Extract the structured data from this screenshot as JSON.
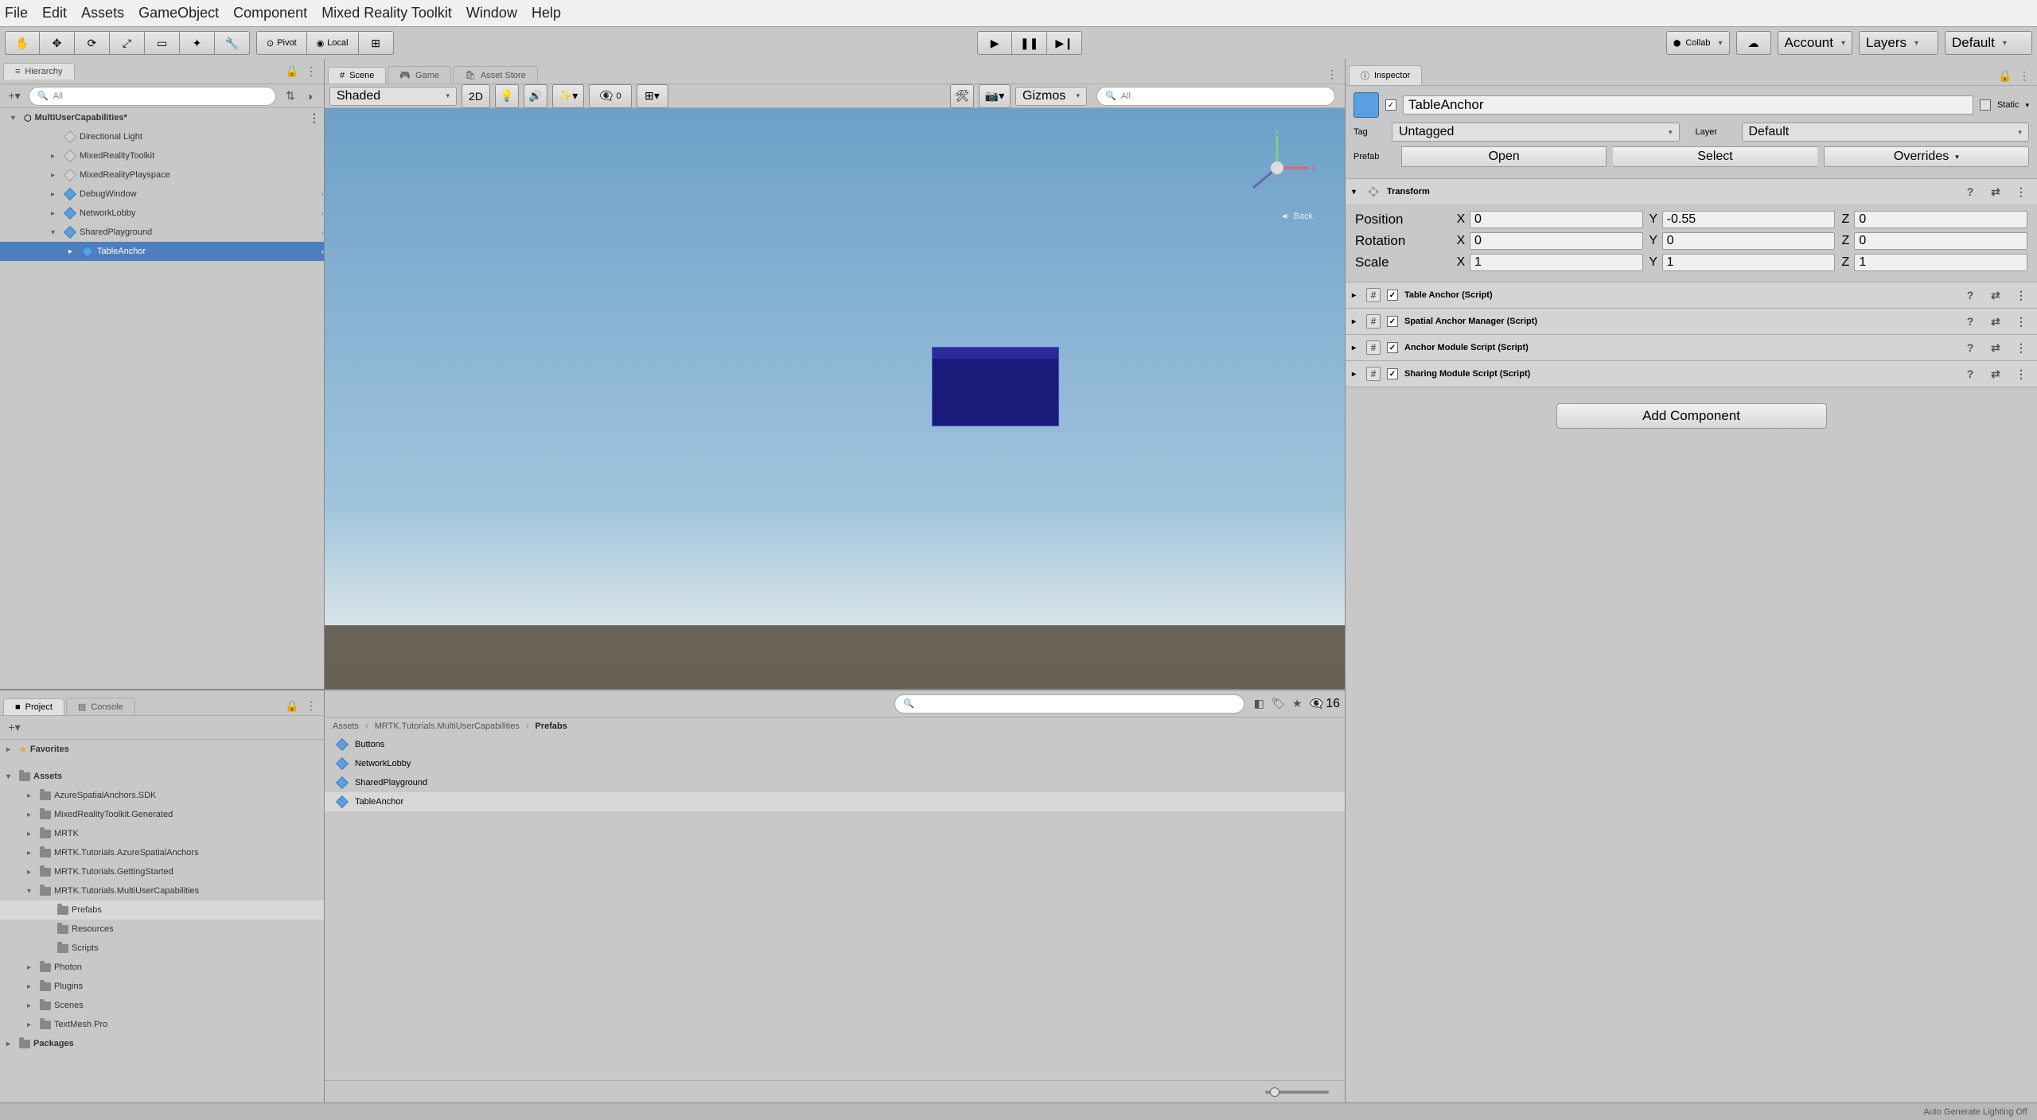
{
  "menubar": [
    "File",
    "Edit",
    "Assets",
    "GameObject",
    "Component",
    "Mixed Reality Toolkit",
    "Window",
    "Help"
  ],
  "toolbar": {
    "pivot": "Pivot",
    "local": "Local",
    "collab": "Collab",
    "account": "Account",
    "layers": "Layers",
    "layout": "Default"
  },
  "hierarchy": {
    "title": "Hierarchy",
    "search_placeholder": "All",
    "scene": "MultiUserCapabilities*",
    "items": [
      {
        "name": "Directional Light",
        "icon": "gray",
        "indent": 2,
        "arrow": ""
      },
      {
        "name": "MixedRealityToolkit",
        "icon": "gray",
        "indent": 2,
        "arrow": "▸"
      },
      {
        "name": "MixedRealityPlayspace",
        "icon": "gray",
        "indent": 2,
        "arrow": "▸"
      },
      {
        "name": "DebugWindow",
        "icon": "blue",
        "indent": 2,
        "arrow": "▸",
        "chev": true
      },
      {
        "name": "NetworkLobby",
        "icon": "blue",
        "indent": 2,
        "arrow": "▸",
        "chev": true
      },
      {
        "name": "SharedPlayground",
        "icon": "blue",
        "indent": 2,
        "arrow": "▾",
        "chev": true
      },
      {
        "name": "TableAnchor",
        "icon": "blue",
        "indent": 3,
        "arrow": "▸",
        "chev": true,
        "selected": true
      }
    ]
  },
  "scene_tabs": {
    "scene": "Scene",
    "game": "Game",
    "store": "Asset Store"
  },
  "scene_toolbar": {
    "shaded": "Shaded",
    "mode2d": "2D",
    "zero": "0",
    "gizmos": "Gizmos",
    "search_placeholder": "All"
  },
  "scene_view": {
    "back": "Back"
  },
  "inspector": {
    "title": "Inspector",
    "name": "TableAnchor",
    "static": "Static",
    "tag_label": "Tag",
    "tag_value": "Untagged",
    "layer_label": "Layer",
    "layer_value": "Default",
    "prefab_label": "Prefab",
    "open": "Open",
    "select": "Select",
    "overrides": "Overrides",
    "transform": {
      "title": "Transform",
      "position": {
        "label": "Position",
        "x": "0",
        "y": "-0.55",
        "z": "0"
      },
      "rotation": {
        "label": "Rotation",
        "x": "0",
        "y": "0",
        "z": "0"
      },
      "scale": {
        "label": "Scale",
        "x": "1",
        "y": "1",
        "z": "1"
      }
    },
    "components": [
      "Table Anchor (Script)",
      "Spatial Anchor Manager (Script)",
      "Anchor Module Script (Script)",
      "Sharing Module Script (Script)"
    ],
    "add_component": "Add Component"
  },
  "project": {
    "title": "Project",
    "console": "Console",
    "favorites": "Favorites",
    "root": "Assets",
    "folders": [
      {
        "name": "AzureSpatialAnchors.SDK",
        "indent": 1
      },
      {
        "name": "MixedRealityToolkit.Generated",
        "indent": 1
      },
      {
        "name": "MRTK",
        "indent": 1
      },
      {
        "name": "MRTK.Tutorials.AzureSpatialAnchors",
        "indent": 1
      },
      {
        "name": "MRTK.Tutorials.GettingStarted",
        "indent": 1
      },
      {
        "name": "MRTK.Tutorials.MultiUserCapabilities",
        "indent": 1,
        "open": true
      },
      {
        "name": "Prefabs",
        "indent": 2,
        "selected": true
      },
      {
        "name": "Resources",
        "indent": 2
      },
      {
        "name": "Scripts",
        "indent": 2
      },
      {
        "name": "Photon",
        "indent": 1
      },
      {
        "name": "Plugins",
        "indent": 1
      },
      {
        "name": "Scenes",
        "indent": 1
      },
      {
        "name": "TextMesh Pro",
        "indent": 1
      }
    ],
    "packages": "Packages",
    "breadcrumb": [
      "Assets",
      "MRTK.Tutorials.MultiUserCapabilities",
      "Prefabs"
    ],
    "assets": [
      {
        "name": "Buttons"
      },
      {
        "name": "NetworkLobby"
      },
      {
        "name": "SharedPlayground"
      },
      {
        "name": "TableAnchor",
        "selected": true
      }
    ],
    "count": "16"
  },
  "statusbar": {
    "lighting": "Auto Generate Lighting Off"
  }
}
